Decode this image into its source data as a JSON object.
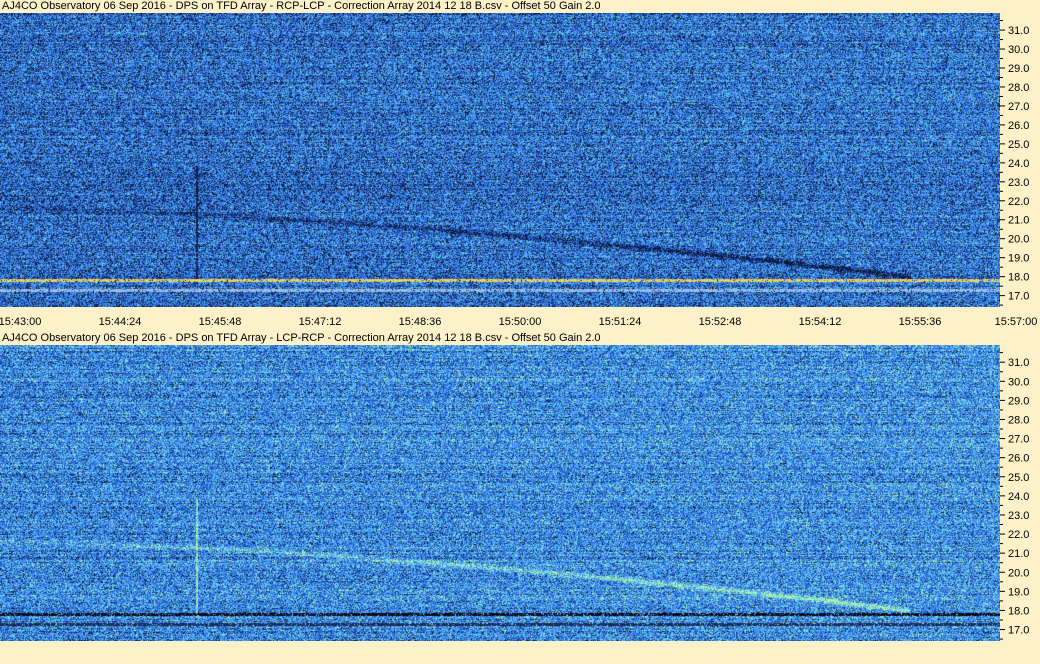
{
  "panels": [
    {
      "title": "AJ4CO Observatory 06 Sep 2016  -  DPS on TFD Array  -  RCP-LCP  -  Correction Array 2014 12 18 B.csv  -  Offset 50  Gain 2.0",
      "palette": "dark",
      "palette_colors": [
        "#0c1a3a",
        "#1c3c8c",
        "#2f69d8",
        "#3a84f0",
        "#4aa8f4",
        "#6cd0e0",
        "#a8f0b0"
      ]
    },
    {
      "title": "AJ4CO Observatory 06 Sep 2016  -  DPS on TFD Array  -  LCP-RCP  -  Correction Array 2014 12 18 B.csv  -  Offset 50  Gain 2.0",
      "palette": "light",
      "palette_colors": [
        "#0c1a3a",
        "#1c4aa0",
        "#2f6ee0",
        "#3c8cf4",
        "#50b0f8",
        "#78d8e8",
        "#b4f4a0"
      ]
    }
  ],
  "chart_data": [
    {
      "type": "heatmap",
      "title": "AJ4CO Observatory 06 Sep 2016  -  DPS on TFD Array  -  RCP-LCP  -  Correction Array 2014 12 18 B.csv  -  Offset 50  Gain 2.0",
      "polarization": "RCP-LCP",
      "x_ticks": [
        "15:43:00",
        "15:44:24",
        "15:45:48",
        "15:47:12",
        "15:48:36",
        "15:50:00",
        "15:51:24",
        "15:52:48",
        "15:54:12",
        "15:55:36",
        "15:57:00"
      ],
      "y_ticks": [
        "17.0",
        "18.0",
        "19.0",
        "20.0",
        "21.0",
        "22.0",
        "23.0",
        "24.0",
        "25.0",
        "26.0",
        "27.0",
        "28.0",
        "29.0",
        "30.0",
        "31.0"
      ],
      "xlim": [
        "15:43:00",
        "15:57:00"
      ],
      "ylim": [
        16.4,
        31.9
      ],
      "features": [
        {
          "kind": "interference_band",
          "y": 17.8,
          "color": "#f0d060"
        },
        {
          "kind": "interference_band",
          "y": 17.3,
          "color": "#a0c0e0"
        },
        {
          "kind": "vertical_line",
          "x": "15:45:45"
        },
        {
          "kind": "sweep",
          "start": [
            "15:43:00",
            21.6
          ],
          "end": [
            "15:55:45",
            18.0
          ],
          "sign": "dark"
        }
      ]
    },
    {
      "type": "heatmap",
      "title": "AJ4CO Observatory 06 Sep 2016  -  DPS on TFD Array  -  LCP-RCP  -  Correction Array 2014 12 18 B.csv  -  Offset 50  Gain 2.0",
      "polarization": "LCP-RCP",
      "x_ticks": [
        "15:43:00",
        "15:44:24",
        "15:45:48",
        "15:47:12",
        "15:48:36",
        "15:50:00",
        "15:51:24",
        "15:52:48",
        "15:54:12",
        "15:55:36",
        "15:57:00"
      ],
      "y_ticks": [
        "17.0",
        "18.0",
        "19.0",
        "20.0",
        "21.0",
        "22.0",
        "23.0",
        "24.0",
        "25.0",
        "26.0",
        "27.0",
        "28.0",
        "29.0",
        "30.0",
        "31.0"
      ],
      "xlim": [
        "15:43:00",
        "15:57:00"
      ],
      "ylim": [
        16.4,
        31.9
      ],
      "features": [
        {
          "kind": "interference_band",
          "y": 17.8,
          "color": "#0a0a14"
        },
        {
          "kind": "interference_band",
          "y": 17.3,
          "color": "#1a2a50"
        },
        {
          "kind": "vertical_line",
          "x": "15:45:45"
        },
        {
          "kind": "sweep",
          "start": [
            "15:43:00",
            21.6
          ],
          "end": [
            "15:55:45",
            18.0
          ],
          "sign": "bright"
        }
      ]
    }
  ]
}
